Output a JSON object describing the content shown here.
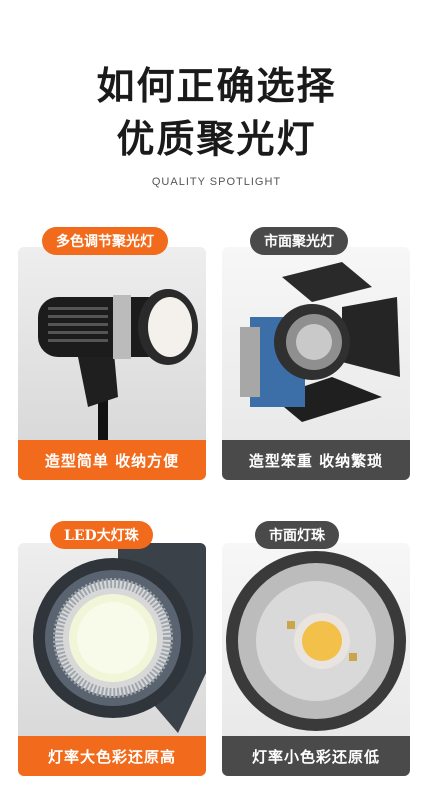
{
  "header": {
    "title_line1": "如何正确选择",
    "title_line2": "优质聚光灯",
    "subtitle": "QUALITY SPOTLIGHT"
  },
  "comparisons": [
    {
      "tag": "多色调节聚光灯",
      "caption": "造型简单 收纳方便",
      "accent": "#f26a1b"
    },
    {
      "tag": "市面聚光灯",
      "caption": "造型笨重 收纳繁琐",
      "accent": "#4a4a4a"
    },
    {
      "tag": "LED大灯珠",
      "caption": "灯率大色彩还原高",
      "accent": "#f26a1b"
    },
    {
      "tag": "市面灯珠",
      "caption": "灯率小色彩还原低",
      "accent": "#4a4a4a"
    }
  ]
}
